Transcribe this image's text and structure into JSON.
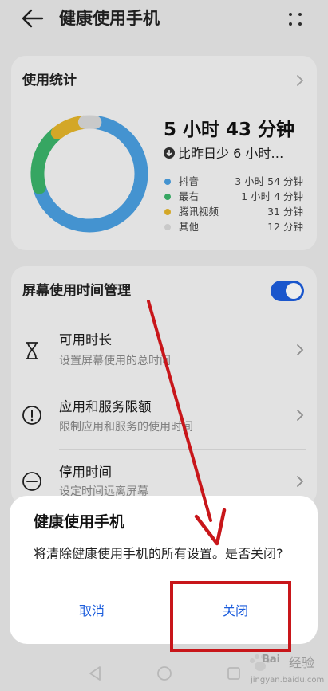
{
  "header": {
    "title": "健康使用手机",
    "back_icon": "arrow-left-icon",
    "more_icon": "grid-more-icon"
  },
  "usage_stats": {
    "title": "使用统计",
    "total_time": "5 小时 43 分钟",
    "compare_text": "比昨日少 6 小时…",
    "legend": [
      {
        "name": "抖音",
        "value": "3 小时 54 分钟",
        "color": "#4a9fe0",
        "minutes": 234
      },
      {
        "name": "最右",
        "value": "1 小时 4 分钟",
        "color": "#3bb36a",
        "minutes": 64
      },
      {
        "name": "腾讯视频",
        "value": "31 分钟",
        "color": "#e3b42a",
        "minutes": 31
      },
      {
        "name": "其他",
        "value": "12 分钟",
        "color": "#d9d9d9",
        "minutes": 12
      }
    ]
  },
  "screen_time": {
    "title": "屏幕使用时间管理",
    "toggle_on": true,
    "items": [
      {
        "title": "可用时长",
        "subtitle": "设置屏幕使用的总时间",
        "icon": "hourglass-icon"
      },
      {
        "title": "应用和服务限额",
        "subtitle": "限制应用和服务的使用时间",
        "icon": "exclamation-circle-icon"
      },
      {
        "title": "停用时间",
        "subtitle": "设定时间远离屏幕",
        "icon": "minus-circle-icon"
      }
    ]
  },
  "dialog": {
    "title": "健康使用手机",
    "message": "将清除健康使用手机的所有设置。是否关闭?",
    "cancel_label": "取消",
    "confirm_label": "关闭"
  },
  "nav_bar": {
    "back": "triangle-back-icon",
    "home": "circle-home-icon",
    "recents": "square-recents-icon"
  },
  "watermark": {
    "brand_text": "经验",
    "url_text": "jingyan.baidu.com",
    "logo_text": "Bai"
  },
  "colors": {
    "accent": "#1c5ddc",
    "annotation_red": "#c8161a"
  }
}
